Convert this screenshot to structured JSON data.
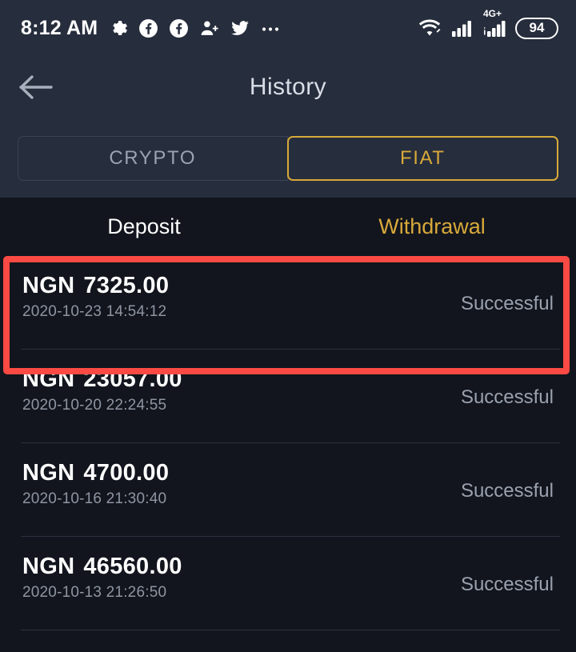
{
  "statusbar": {
    "time": "8:12 AM",
    "left_icons": [
      "gear-icon",
      "facebook-icon",
      "facebook-icon",
      "person-add-icon",
      "twitter-icon",
      "more-icon"
    ],
    "right_icons": [
      "wifi-icon",
      "signal-icon",
      "mobile-data-icon"
    ],
    "network_label": "4G+",
    "battery_level": "94"
  },
  "header": {
    "back_icon": "back-arrow-icon",
    "title": "History"
  },
  "asset_toggle": {
    "options": [
      "CRYPTO",
      "FIAT"
    ],
    "crypto_label": "CRYPTO",
    "fiat_label": "FIAT",
    "selected": "FIAT",
    "accent_color": "#d8a93a"
  },
  "sub_tabs": {
    "deposit_label": "Deposit",
    "withdrawal_label": "Withdrawal",
    "selected": "Withdrawal",
    "active_color": "#d8a93a",
    "inactive_color": "#ffffff"
  },
  "highlight": {
    "color": "#fb4a44",
    "target": "first-transaction-row"
  },
  "transactions": [
    {
      "currency": "NGN",
      "amount": "7325.00",
      "timestamp": "2020-10-23 14:54:12",
      "status": "Successful"
    },
    {
      "currency": "NGN",
      "amount": "23057.00",
      "timestamp": "2020-10-20 22:24:55",
      "status": "Successful"
    },
    {
      "currency": "NGN",
      "amount": "4700.00",
      "timestamp": "2020-10-16 21:30:40",
      "status": "Successful"
    },
    {
      "currency": "NGN",
      "amount": "46560.00",
      "timestamp": "2020-10-13 21:26:50",
      "status": "Successful"
    }
  ]
}
